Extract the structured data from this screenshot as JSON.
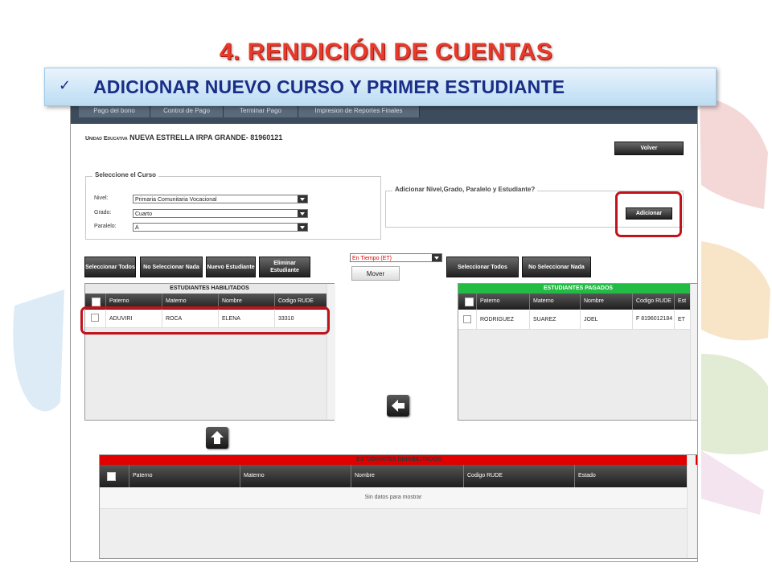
{
  "slide": {
    "title": "4. RENDICIÓN  DE CUENTAS",
    "subtitle": "ADICIONAR NUEVO CURSO Y PRIMER ESTUDIANTE",
    "check_icon": "check-icon",
    "title_color": "#e83a2a",
    "subtitle_color": "#1a2e88"
  },
  "app": {
    "menu_tabs": [
      "Pago del bono",
      "Control de Pago",
      "Terminar Pago",
      "Impresion de Reportes Finales"
    ],
    "school_prefix": "Unidad Educativa",
    "school_name": "NUEVA ESTRELLA IRPA GRANDE- 81960121",
    "volver_label": "Volver",
    "course_section": {
      "legend": "Seleccione el Curso",
      "nivel_label": "Nivel:",
      "nivel_value": "Primaria Comunitaria Vocacional",
      "grado_label": "Grado:",
      "grado_value": "Cuarto",
      "paralelo_label": "Paralelo:",
      "paralelo_value": "A"
    },
    "add_section": {
      "legend": "Adicionar Nivel,Grado, Paralelo y Estudiante?",
      "button_label": "Adicionar"
    },
    "left_buttons": {
      "select_all": "Seleccionar Todos",
      "select_none": "No Seleccionar Nada",
      "new_student": "Nuevo Estudiante",
      "delete_student": "Eliminar Estudiante"
    },
    "move_select": "En Tiempo (ET)",
    "move_button": "Mover",
    "right_buttons": {
      "select_all": "Seleccionar Todos",
      "select_none": "No Seleccionar Nada"
    },
    "enabled_grid": {
      "title": "ESTUDIANTES HABILITADOS",
      "columns": [
        "Paterno",
        "Materno",
        "Nombre",
        "Codigo RUDE"
      ],
      "rows": [
        [
          "ADUVIRI",
          "ROCA",
          "ELENA",
          "33310"
        ]
      ]
    },
    "paid_grid": {
      "title": "ESTUDIANTES PAGADOS",
      "title_color": "#22bb44",
      "columns": [
        "Paterno",
        "Materno",
        "Nombre",
        "Codigo RUDE",
        "Est"
      ],
      "rows": [
        [
          "RODRIGUEZ",
          "SUAREZ",
          "JOEL",
          "F 8196012184",
          "ET"
        ]
      ]
    },
    "disabled_grid": {
      "title": "ESTUDIANTES INHABILITADOS",
      "title_color": "#e00000",
      "columns": [
        "Paterno",
        "Materno",
        "Nombre",
        "Codigo RUDE",
        "Estado"
      ],
      "empty_text": "Sin datos para mostrar"
    },
    "icons": {
      "move_left": "arrow-left-icon",
      "move_up": "arrow-up-icon"
    }
  }
}
